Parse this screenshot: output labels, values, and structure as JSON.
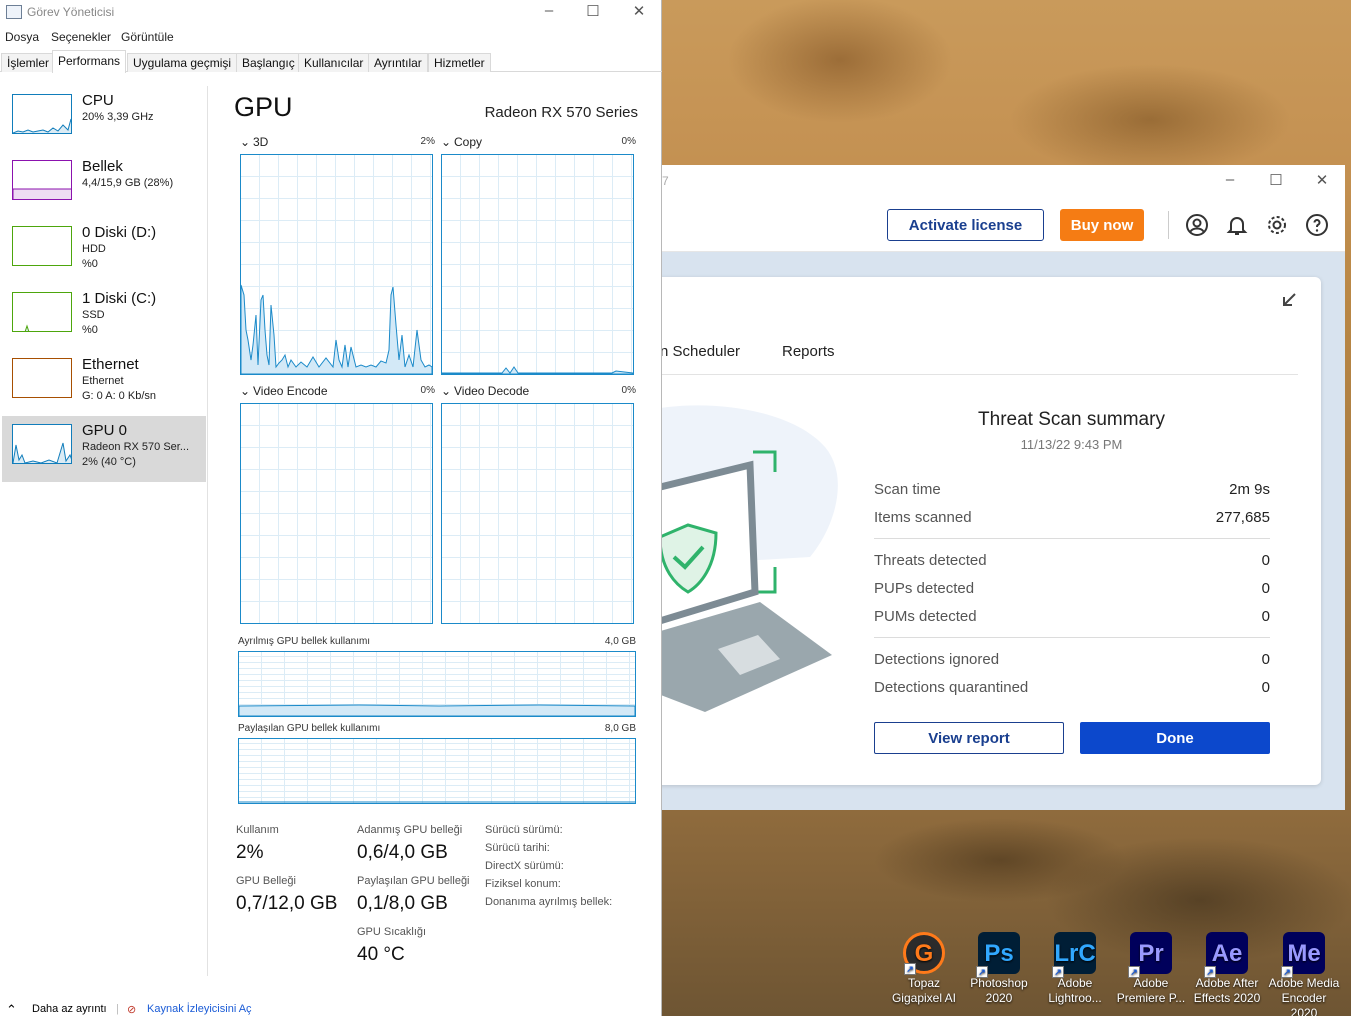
{
  "desktop": {
    "icons": [
      {
        "label": "Topaz Gigapixel AI",
        "glyph": "G",
        "bg": "#2b2b2b",
        "fg": "#ff7a1a",
        "icon": "topaz-icon"
      },
      {
        "label": "Photoshop 2020",
        "glyph": "Ps",
        "bg": "#001e36",
        "fg": "#31a8ff",
        "icon": "photoshop-icon"
      },
      {
        "label": "Adobe Lightroo...",
        "glyph": "LrC",
        "bg": "#001e36",
        "fg": "#31a8ff",
        "icon": "lightroom-icon"
      },
      {
        "label": "Adobe Premiere P...",
        "glyph": "Pr",
        "bg": "#00005b",
        "fg": "#9999ff",
        "icon": "premiere-icon"
      },
      {
        "label": "Adobe After Effects 2020",
        "glyph": "Ae",
        "bg": "#00005b",
        "fg": "#9999ff",
        "icon": "after-effects-icon"
      },
      {
        "label": "Adobe Media Encoder 2020",
        "glyph": "Me",
        "bg": "#00005b",
        "fg": "#9999ff",
        "icon": "media-encoder-icon"
      }
    ]
  },
  "malwarebytes": {
    "title_fragment": "7",
    "header": {
      "activate": "Activate license",
      "buy": "Buy now"
    },
    "tabs": {
      "scheduler": "n Scheduler",
      "reports": "Reports"
    },
    "summary": {
      "title": "Threat Scan summary",
      "date": "11/13/22 9:43 PM",
      "rows": [
        {
          "label": "Scan time",
          "value": "2m 9s"
        },
        {
          "label": "Items scanned",
          "value": "277,685"
        },
        {
          "label": "Threats detected",
          "value": "0"
        },
        {
          "label": "PUPs detected",
          "value": "0"
        },
        {
          "label": "PUMs detected",
          "value": "0"
        },
        {
          "label": "Detections ignored",
          "value": "0"
        },
        {
          "label": "Detections quarantined",
          "value": "0"
        }
      ],
      "view_report": "View report",
      "done": "Done"
    },
    "colors": {
      "accent": "#0c48cc",
      "buy": "#f57c14",
      "shield": "#2fb36b"
    }
  },
  "taskmanager": {
    "title": "Görev Yöneticisi",
    "menu": [
      "Dosya",
      "Seçenekler",
      "Görüntüle"
    ],
    "tabs": [
      "İşlemler",
      "Performans",
      "Uygulama geçmişi",
      "Başlangıç",
      "Kullanıcılar",
      "Ayrıntılar",
      "Hizmetler"
    ],
    "sidebar": [
      {
        "name": "CPU",
        "line1": "20%  3,39 GHz",
        "line2": "",
        "color": "#117dbb"
      },
      {
        "name": "Bellek",
        "line1": "4,4/15,9 GB (28%)",
        "line2": "",
        "color": "#8b12ae"
      },
      {
        "name": "0 Diski (D:)",
        "line1": "HDD",
        "line2": "%0",
        "color": "#4da60c"
      },
      {
        "name": "1 Diski (C:)",
        "line1": "SSD",
        "line2": "%0",
        "color": "#4da60c"
      },
      {
        "name": "Ethernet",
        "line1": "Ethernet",
        "line2": "G: 0  A: 0 Kb/sn",
        "color": "#a74f01"
      },
      {
        "name": "GPU 0",
        "line1": "Radeon RX 570 Ser...",
        "line2": "2%  (40 °C)",
        "color": "#117dbb"
      }
    ],
    "gpu": {
      "heading": "GPU",
      "model": "Radeon RX 570 Series",
      "engines": [
        {
          "name": "3D",
          "pct": "2%"
        },
        {
          "name": "Copy",
          "pct": "0%"
        },
        {
          "name": "Video Encode",
          "pct": "0%"
        },
        {
          "name": "Video Decode",
          "pct": "0%"
        }
      ],
      "dedicated_label": "Ayrılmış GPU bellek kullanımı",
      "dedicated_max": "4,0 GB",
      "shared_label": "Paylaşılan GPU bellek kullanımı",
      "shared_max": "8,0 GB",
      "stats": {
        "usage_label": "Kullanım",
        "usage": "2%",
        "dedicated_mem_label": "Adanmış GPU belleği",
        "dedicated_mem": "0,6/4,0 GB",
        "gpu_mem_label": "GPU Belleği",
        "gpu_mem": "0,7/12,0 GB",
        "shared_mem_label": "Paylaşılan GPU belleği",
        "shared_mem": "0,1/8,0 GB",
        "temp_label": "GPU Sıcaklığı",
        "temp": "40 °C"
      },
      "driver": [
        "Sürücü sürümü:",
        "Sürücü tarihi:",
        "DirectX sürümü:",
        "Fiziksel konum:",
        "Donanıma ayrılmış bellek:"
      ]
    },
    "footer": {
      "less": "Daha az ayrıntı",
      "monitor": "Kaynak İzleyicisini Aç"
    }
  }
}
